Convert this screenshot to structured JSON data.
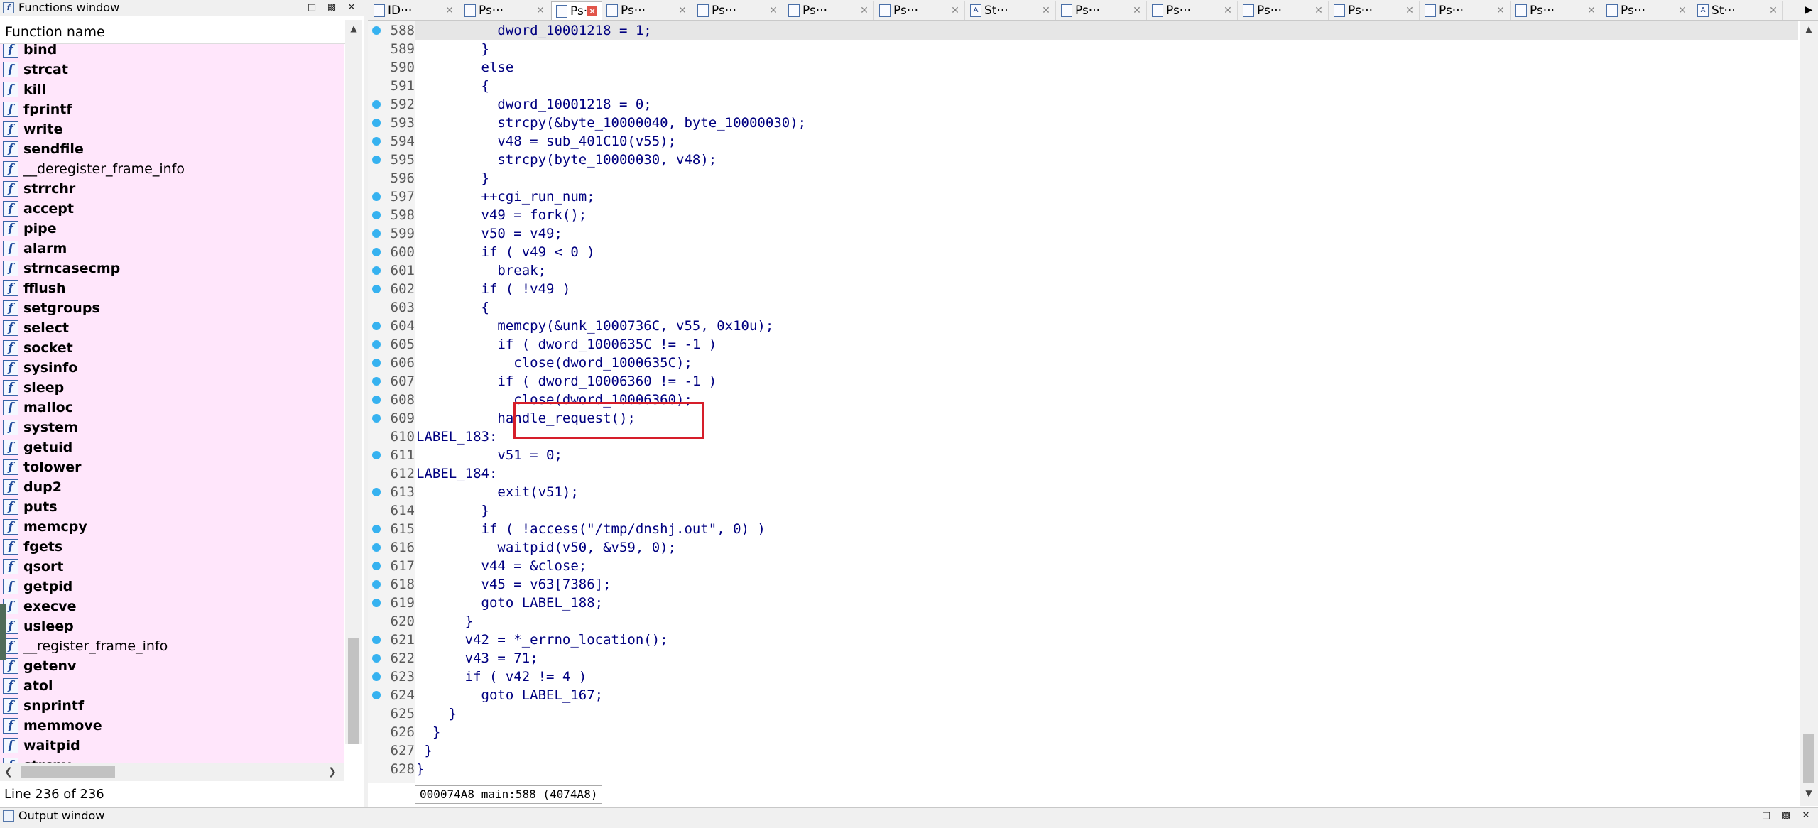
{
  "functions_window": {
    "title": "Functions window",
    "column_header": "Function name",
    "items": [
      {
        "name": "bind",
        "thin": false
      },
      {
        "name": "strcat",
        "thin": false
      },
      {
        "name": "kill",
        "thin": false
      },
      {
        "name": "fprintf",
        "thin": false
      },
      {
        "name": "write",
        "thin": false
      },
      {
        "name": "sendfile",
        "thin": false
      },
      {
        "name": "__deregister_frame_info",
        "thin": true
      },
      {
        "name": "strrchr",
        "thin": false
      },
      {
        "name": "accept",
        "thin": false
      },
      {
        "name": "pipe",
        "thin": false
      },
      {
        "name": "alarm",
        "thin": false
      },
      {
        "name": "strncasecmp",
        "thin": false
      },
      {
        "name": "fflush",
        "thin": false
      },
      {
        "name": "setgroups",
        "thin": false
      },
      {
        "name": "select",
        "thin": false
      },
      {
        "name": "socket",
        "thin": false
      },
      {
        "name": "sysinfo",
        "thin": false
      },
      {
        "name": "sleep",
        "thin": false
      },
      {
        "name": "malloc",
        "thin": false
      },
      {
        "name": "system",
        "thin": false
      },
      {
        "name": "getuid",
        "thin": false
      },
      {
        "name": "tolower",
        "thin": false
      },
      {
        "name": "dup2",
        "thin": false
      },
      {
        "name": "puts",
        "thin": false
      },
      {
        "name": "memcpy",
        "thin": false
      },
      {
        "name": "fgets",
        "thin": false
      },
      {
        "name": "qsort",
        "thin": false
      },
      {
        "name": "getpid",
        "thin": false
      },
      {
        "name": "execve",
        "thin": false
      },
      {
        "name": "usleep",
        "thin": false
      },
      {
        "name": "__register_frame_info",
        "thin": true
      },
      {
        "name": "getenv",
        "thin": false
      },
      {
        "name": "atol",
        "thin": false
      },
      {
        "name": "snprintf",
        "thin": false
      },
      {
        "name": "memmove",
        "thin": false
      },
      {
        "name": "waitpid",
        "thin": false
      },
      {
        "name": "strcpy",
        "thin": false
      }
    ],
    "status": "Line 236 of 236"
  },
  "tabs": [
    {
      "label": "ID···",
      "active": false
    },
    {
      "label": "Ps···",
      "active": false
    },
    {
      "label": "Ps···",
      "active": true
    },
    {
      "label": "Ps···",
      "active": false
    },
    {
      "label": "Ps···",
      "active": false
    },
    {
      "label": "Ps···",
      "active": false
    },
    {
      "label": "Ps···",
      "active": false
    },
    {
      "label": "St···",
      "active": false
    },
    {
      "label": "Ps···",
      "active": false
    },
    {
      "label": "Ps···",
      "active": false
    },
    {
      "label": "Ps···",
      "active": false
    },
    {
      "label": "Ps···",
      "active": false
    },
    {
      "label": "Ps···",
      "active": false
    },
    {
      "label": "Ps···",
      "active": false
    },
    {
      "label": "Ps···",
      "active": false
    },
    {
      "label": "St···",
      "active": false
    }
  ],
  "code_lines": [
    {
      "num": "588",
      "dot": true,
      "text": "          dword_10001218 = 1;"
    },
    {
      "num": "589",
      "dot": false,
      "text": "        }"
    },
    {
      "num": "590",
      "dot": false,
      "text": "        else"
    },
    {
      "num": "591",
      "dot": false,
      "text": "        {"
    },
    {
      "num": "592",
      "dot": true,
      "text": "          dword_10001218 = 0;"
    },
    {
      "num": "593",
      "dot": true,
      "text": "          strcpy(&byte_10000040, byte_10000030);"
    },
    {
      "num": "594",
      "dot": true,
      "text": "          v48 = sub_401C10(v55);"
    },
    {
      "num": "595",
      "dot": true,
      "text": "          strcpy(byte_10000030, v48);"
    },
    {
      "num": "596",
      "dot": false,
      "text": "        }"
    },
    {
      "num": "597",
      "dot": true,
      "text": "        ++cgi_run_num;"
    },
    {
      "num": "598",
      "dot": true,
      "text": "        v49 = fork();"
    },
    {
      "num": "599",
      "dot": true,
      "text": "        v50 = v49;"
    },
    {
      "num": "600",
      "dot": true,
      "text": "        if ( v49 < 0 )"
    },
    {
      "num": "601",
      "dot": true,
      "text": "          break;"
    },
    {
      "num": "602",
      "dot": true,
      "text": "        if ( !v49 )"
    },
    {
      "num": "603",
      "dot": false,
      "text": "        {"
    },
    {
      "num": "604",
      "dot": true,
      "text": "          memcpy(&unk_1000736C, v55, 0x10u);"
    },
    {
      "num": "605",
      "dot": true,
      "text": "          if ( dword_1000635C != -1 )"
    },
    {
      "num": "606",
      "dot": true,
      "text": "            close(dword_1000635C);"
    },
    {
      "num": "607",
      "dot": true,
      "text": "          if ( dword_10006360 != -1 )"
    },
    {
      "num": "608",
      "dot": true,
      "text": "            close(dword_10006360);"
    },
    {
      "num": "609",
      "dot": true,
      "text": "          handle_request();"
    },
    {
      "num": "610",
      "dot": false,
      "text": "LABEL_183:"
    },
    {
      "num": "611",
      "dot": true,
      "text": "          v51 = 0;"
    },
    {
      "num": "612",
      "dot": false,
      "text": "LABEL_184:"
    },
    {
      "num": "613",
      "dot": true,
      "text": "          exit(v51);"
    },
    {
      "num": "614",
      "dot": false,
      "text": "        }"
    },
    {
      "num": "615",
      "dot": true,
      "text": "        if ( !access(\"/tmp/dnshj.out\", 0) )"
    },
    {
      "num": "616",
      "dot": true,
      "text": "          waitpid(v50, &v59, 0);"
    },
    {
      "num": "617",
      "dot": true,
      "text": "        v44 = &close;"
    },
    {
      "num": "618",
      "dot": true,
      "text": "        v45 = v63[7386];"
    },
    {
      "num": "619",
      "dot": true,
      "text": "        goto LABEL_188;"
    },
    {
      "num": "620",
      "dot": false,
      "text": "      }"
    },
    {
      "num": "621",
      "dot": true,
      "text": "      v42 = *_errno_location();"
    },
    {
      "num": "622",
      "dot": true,
      "text": "      v43 = 71;"
    },
    {
      "num": "623",
      "dot": true,
      "text": "      if ( v42 != 4 )"
    },
    {
      "num": "624",
      "dot": true,
      "text": "        goto LABEL_167;"
    },
    {
      "num": "625",
      "dot": false,
      "text": "    }"
    },
    {
      "num": "626",
      "dot": false,
      "text": "  }"
    },
    {
      "num": "627",
      "dot": false,
      "text": " }"
    },
    {
      "num": "628",
      "dot": false,
      "text": "}"
    }
  ],
  "code_status": "000074A8 main:588 (4074A8)",
  "output_window": {
    "title": "Output window"
  },
  "colors": {
    "breakpoint_dot": "#36b2f0",
    "function_list_bg": "#ffe6fb",
    "highlight_box": "#d61e2a",
    "code_text": "#000080"
  }
}
